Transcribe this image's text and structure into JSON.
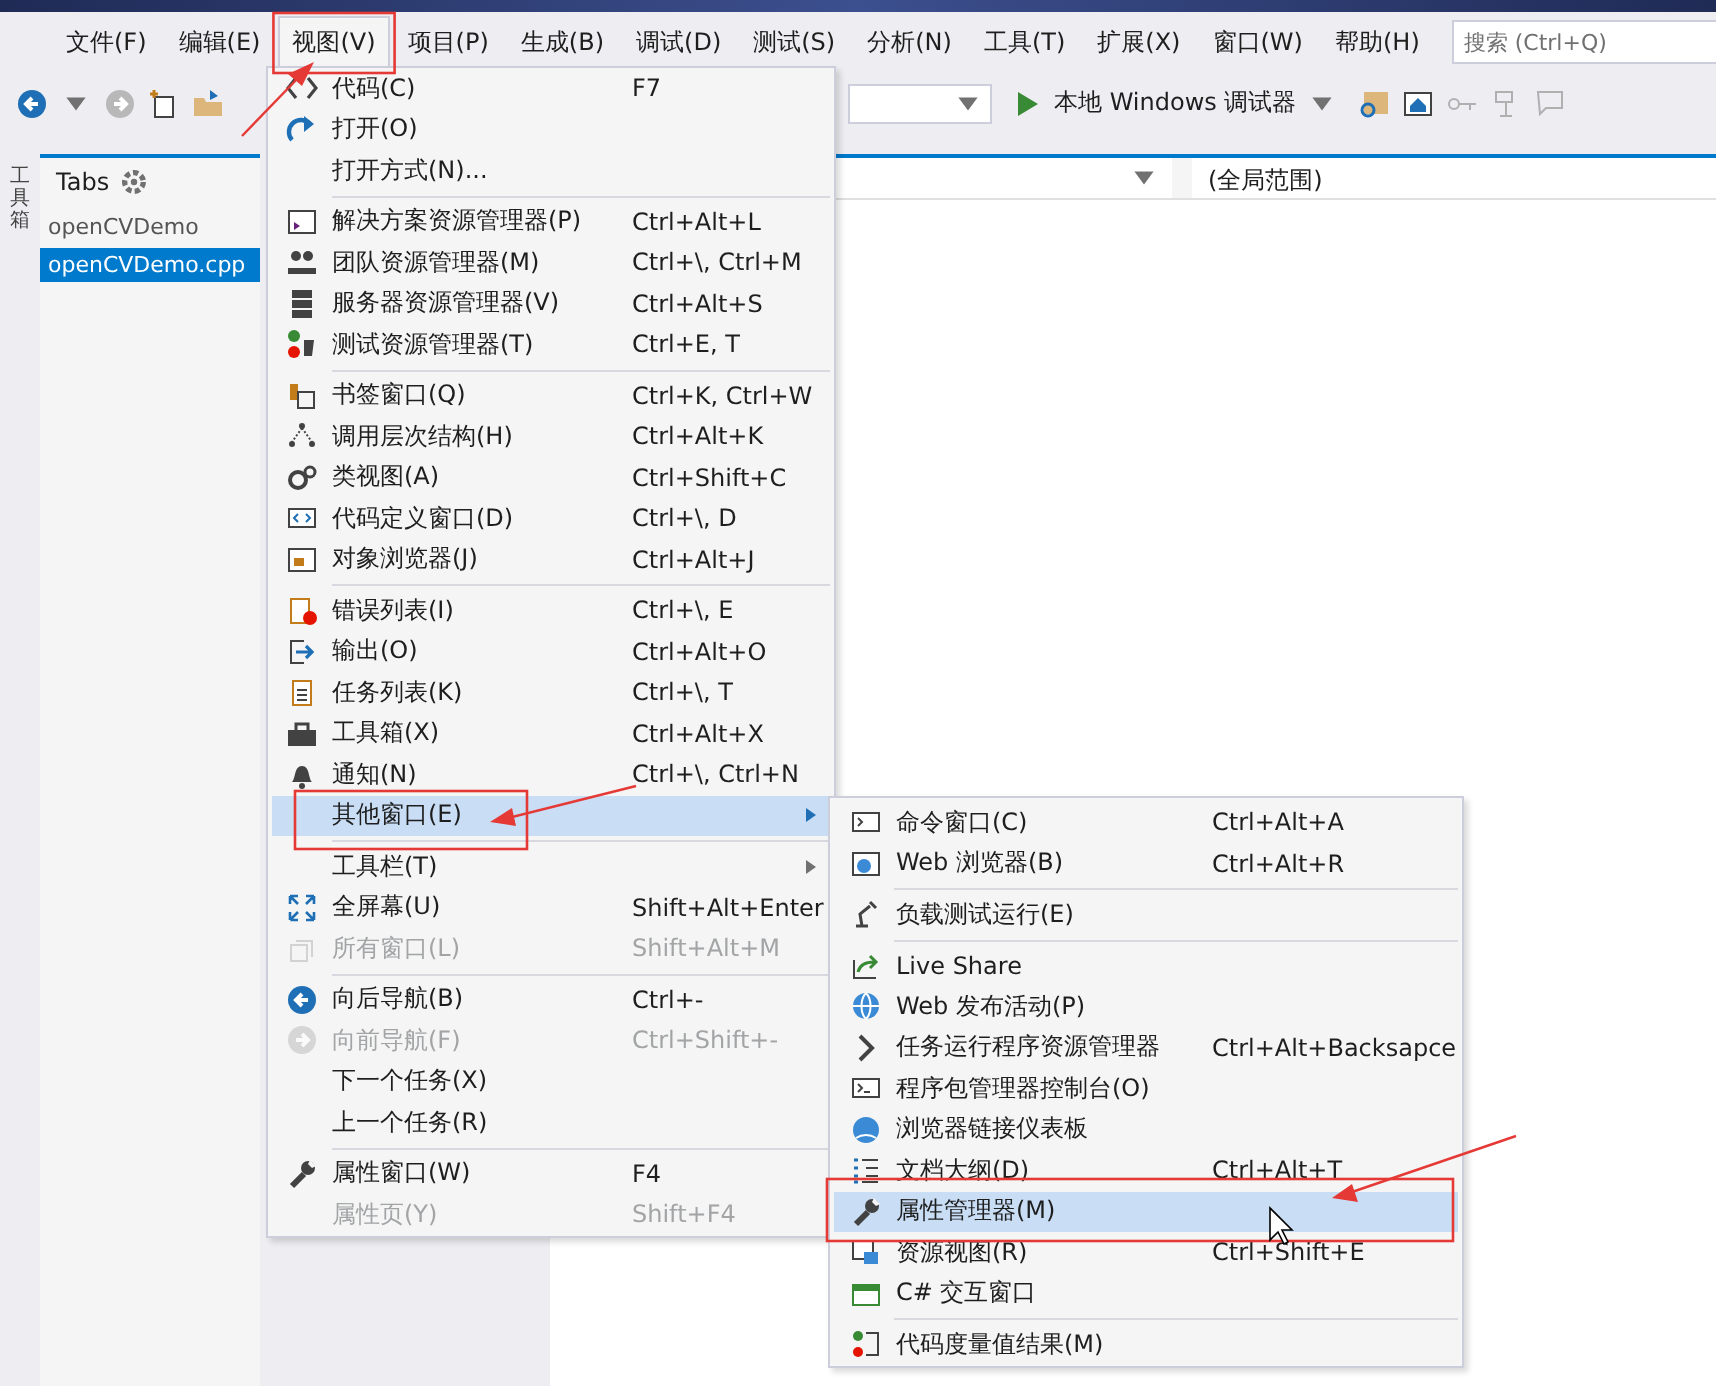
{
  "menubar": {
    "items": [
      {
        "label": "文件(F)",
        "selected": false
      },
      {
        "label": "编辑(E)",
        "selected": false
      },
      {
        "label": "视图(V)",
        "selected": true
      },
      {
        "label": "项目(P)",
        "selected": false
      },
      {
        "label": "生成(B)",
        "selected": false
      },
      {
        "label": "调试(D)",
        "selected": false
      },
      {
        "label": "测试(S)",
        "selected": false
      },
      {
        "label": "分析(N)",
        "selected": false
      },
      {
        "label": "工具(T)",
        "selected": false
      },
      {
        "label": "扩展(X)",
        "selected": false
      },
      {
        "label": "窗口(W)",
        "selected": false
      },
      {
        "label": "帮助(H)",
        "selected": false
      }
    ],
    "search": {
      "placeholder": "搜索 (Ctrl+Q)"
    }
  },
  "toolbar": {
    "run_button": "本地 Windows 调试器"
  },
  "toolbox_strip": {
    "label": "工具箱"
  },
  "tabs_panel": {
    "title": "Tabs",
    "items": [
      {
        "label": "openCVDemo",
        "kind": "project",
        "selected": false
      },
      {
        "label": "openCVDemo.cpp",
        "kind": "file",
        "selected": true
      }
    ]
  },
  "navigation_bar": {
    "scope": "(全局范围)"
  },
  "view_menu": {
    "items": [
      {
        "kind": "item",
        "label": "代码(C)",
        "shortcut": "F7",
        "disabled": false,
        "selected": false,
        "submenu": false
      },
      {
        "kind": "item",
        "label": "打开(O)",
        "disabled": false,
        "selected": false,
        "submenu": false
      },
      {
        "kind": "item",
        "label": "打开方式(N)...",
        "disabled": false,
        "selected": false,
        "submenu": false
      },
      {
        "kind": "separator"
      },
      {
        "kind": "item",
        "label": "解决方案资源管理器(P)",
        "shortcut": "Ctrl+Alt+L",
        "disabled": false,
        "selected": false,
        "submenu": false
      },
      {
        "kind": "item",
        "label": "团队资源管理器(M)",
        "shortcut": "Ctrl+\\, Ctrl+M",
        "disabled": false,
        "selected": false,
        "submenu": false
      },
      {
        "kind": "item",
        "label": "服务器资源管理器(V)",
        "shortcut": "Ctrl+Alt+S",
        "disabled": false,
        "selected": false,
        "submenu": false
      },
      {
        "kind": "item",
        "label": "测试资源管理器(T)",
        "shortcut": "Ctrl+E, T",
        "disabled": false,
        "selected": false,
        "submenu": false
      },
      {
        "kind": "separator"
      },
      {
        "kind": "item",
        "label": "书签窗口(Q)",
        "shortcut": "Ctrl+K, Ctrl+W",
        "disabled": false,
        "selected": false,
        "submenu": false
      },
      {
        "kind": "item",
        "label": "调用层次结构(H)",
        "shortcut": "Ctrl+Alt+K",
        "disabled": false,
        "selected": false,
        "submenu": false
      },
      {
        "kind": "item",
        "label": "类视图(A)",
        "shortcut": "Ctrl+Shift+C",
        "disabled": false,
        "selected": false,
        "submenu": false
      },
      {
        "kind": "item",
        "label": "代码定义窗口(D)",
        "shortcut": "Ctrl+\\, D",
        "disabled": false,
        "selected": false,
        "submenu": false
      },
      {
        "kind": "item",
        "label": "对象浏览器(J)",
        "shortcut": "Ctrl+Alt+J",
        "disabled": false,
        "selected": false,
        "submenu": false
      },
      {
        "kind": "separator"
      },
      {
        "kind": "item",
        "label": "错误列表(I)",
        "shortcut": "Ctrl+\\, E",
        "disabled": false,
        "selected": false,
        "submenu": false
      },
      {
        "kind": "item",
        "label": "输出(O)",
        "shortcut": "Ctrl+Alt+O",
        "disabled": false,
        "selected": false,
        "submenu": false
      },
      {
        "kind": "item",
        "label": "任务列表(K)",
        "shortcut": "Ctrl+\\, T",
        "disabled": false,
        "selected": false,
        "submenu": false
      },
      {
        "kind": "item",
        "label": "工具箱(X)",
        "shortcut": "Ctrl+Alt+X",
        "disabled": false,
        "selected": false,
        "submenu": false
      },
      {
        "kind": "item",
        "label": "通知(N)",
        "shortcut": "Ctrl+\\, Ctrl+N",
        "disabled": false,
        "selected": false,
        "submenu": false
      },
      {
        "kind": "item",
        "label": "其他窗口(E)",
        "disabled": false,
        "selected": true,
        "submenu": true
      },
      {
        "kind": "separator"
      },
      {
        "kind": "item",
        "label": "工具栏(T)",
        "disabled": false,
        "selected": false,
        "submenu": true
      },
      {
        "kind": "item",
        "label": "全屏幕(U)",
        "shortcut": "Shift+Alt+Enter",
        "disabled": false,
        "selected": false,
        "submenu": false
      },
      {
        "kind": "item",
        "label": "所有窗口(L)",
        "shortcut": "Shift+Alt+M",
        "disabled": true,
        "selected": false,
        "submenu": false
      },
      {
        "kind": "separator"
      },
      {
        "kind": "item",
        "label": "向后导航(B)",
        "shortcut": "Ctrl+-",
        "disabled": false,
        "selected": false,
        "submenu": false
      },
      {
        "kind": "item",
        "label": "向前导航(F)",
        "shortcut": "Ctrl+Shift+-",
        "disabled": true,
        "selected": false,
        "submenu": false
      },
      {
        "kind": "item",
        "label": "下一个任务(X)",
        "disabled": false,
        "selected": false,
        "submenu": false
      },
      {
        "kind": "item",
        "label": "上一个任务(R)",
        "disabled": false,
        "selected": false,
        "submenu": false
      },
      {
        "kind": "separator"
      },
      {
        "kind": "item",
        "label": "属性窗口(W)",
        "shortcut": "F4",
        "disabled": false,
        "selected": false,
        "submenu": false
      },
      {
        "kind": "item",
        "label": "属性页(Y)",
        "shortcut": "Shift+F4",
        "disabled": true,
        "selected": false,
        "submenu": false
      }
    ]
  },
  "other_windows_submenu": {
    "items": [
      {
        "kind": "item",
        "label": "命令窗口(C)",
        "shortcut": "Ctrl+Alt+A",
        "selected": false
      },
      {
        "kind": "item",
        "label": "Web 浏览器(B)",
        "shortcut": "Ctrl+Alt+R",
        "selected": false
      },
      {
        "kind": "separator"
      },
      {
        "kind": "item",
        "label": "负载测试运行(E)",
        "selected": false
      },
      {
        "kind": "separator"
      },
      {
        "kind": "item",
        "label": "Live Share",
        "selected": false
      },
      {
        "kind": "item",
        "label": "Web 发布活动(P)",
        "selected": false
      },
      {
        "kind": "item",
        "label": "任务运行程序资源管理器",
        "shortcut": "Ctrl+Alt+Backsapce",
        "selected": false
      },
      {
        "kind": "item",
        "label": "程序包管理器控制台(O)",
        "selected": false
      },
      {
        "kind": "item",
        "label": "浏览器链接仪表板",
        "selected": false
      },
      {
        "kind": "item",
        "label": "文档大纲(D)",
        "shortcut": "Ctrl+Alt+T",
        "selected": false
      },
      {
        "kind": "item",
        "label": "属性管理器(M)",
        "selected": true
      },
      {
        "kind": "item",
        "label": "资源视图(R)",
        "shortcut": "Ctrl+Shift+E",
        "selected": false
      },
      {
        "kind": "item",
        "label": "C# 交互窗口",
        "selected": false
      },
      {
        "kind": "separator"
      },
      {
        "kind": "item",
        "label": "代码度量值结果(M)",
        "selected": false
      }
    ]
  }
}
